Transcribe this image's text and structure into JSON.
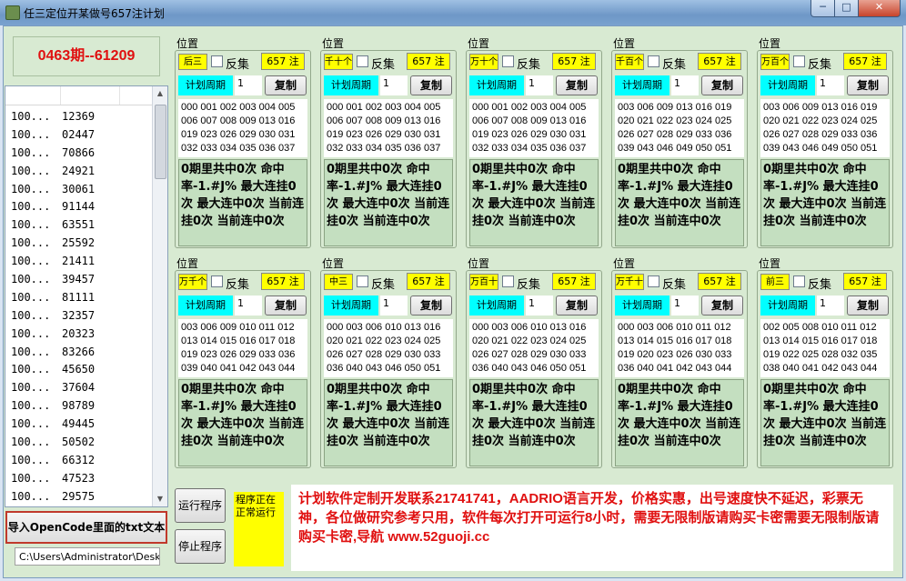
{
  "window": {
    "title": "任三定位开某做号657注计划",
    "minimize": "─",
    "maximize": "□",
    "close": "✕"
  },
  "left": {
    "issue": "0463期--61209",
    "list": [
      [
        "100...",
        "12369"
      ],
      [
        "100...",
        "02447"
      ],
      [
        "100...",
        "70866"
      ],
      [
        "100...",
        "24921"
      ],
      [
        "100...",
        "30061"
      ],
      [
        "100...",
        "91144"
      ],
      [
        "100...",
        "63551"
      ],
      [
        "100...",
        "25592"
      ],
      [
        "100...",
        "21411"
      ],
      [
        "100...",
        "39457"
      ],
      [
        "100...",
        "81111"
      ],
      [
        "100...",
        "32357"
      ],
      [
        "100...",
        "20323"
      ],
      [
        "100...",
        "83266"
      ],
      [
        "100...",
        "45650"
      ],
      [
        "100...",
        "37604"
      ],
      [
        "100...",
        "98789"
      ],
      [
        "100...",
        "49445"
      ],
      [
        "100...",
        "50502"
      ],
      [
        "100...",
        "66312"
      ],
      [
        "100...",
        "47523"
      ],
      [
        "100...",
        "29575"
      ]
    ],
    "import_button": "导入OpenCode里面的txt文本",
    "path": "C:\\Users\\Administrator\\Desk"
  },
  "panels": [
    {
      "pos": "位置",
      "sel": "后三",
      "reverse": "反集",
      "notes": "657 注",
      "period": "计划周期",
      "period_value": "1",
      "copy": "复制",
      "numbers": "000 001 002 003 004 005 006 007 008 009 013 016 019 023 026 029 030 031 032 033 034 035 036 037",
      "stats": "0期里共中0次 命中率-1.#J% 最大连挂0次 最大连中0次 当前连挂0次 当前连中0次"
    },
    {
      "pos": "位置",
      "sel": "千十个",
      "reverse": "反集",
      "notes": "657 注",
      "period": "计划周期",
      "period_value": "1",
      "copy": "复制",
      "numbers": "000 001 002 003 004 005 006 007 008 009 013 016 019 023 026 029 030 031 032 033 034 035 036 037",
      "stats": "0期里共中0次 命中率-1.#J% 最大连挂0次 最大连中0次 当前连挂0次 当前连中0次"
    },
    {
      "pos": "位置",
      "sel": "万十个",
      "reverse": "反集",
      "notes": "657 注",
      "period": "计划周期",
      "period_value": "1",
      "copy": "复制",
      "numbers": "000 001 002 003 004 005 006 007 008 009 013 016 019 023 026 029 030 031 032 033 034 035 036 037",
      "stats": "0期里共中0次 命中率-1.#J% 最大连挂0次 最大连中0次 当前连挂0次 当前连中0次"
    },
    {
      "pos": "位置",
      "sel": "千百个",
      "reverse": "反集",
      "notes": "657 注",
      "period": "计划周期",
      "period_value": "1",
      "copy": "复制",
      "numbers": "003 006 009 013 016 019 020 021 022 023 024 025 026 027 028 029 033 036 039 043 046 049 050 051",
      "stats": "0期里共中0次 命中率-1.#J% 最大连挂0次 最大连中0次 当前连挂0次 当前连中0次"
    },
    {
      "pos": "位置",
      "sel": "万百个",
      "reverse": "反集",
      "notes": "657 注",
      "period": "计划周期",
      "period_value": "1",
      "copy": "复制",
      "numbers": "003 006 009 013 016 019 020 021 022 023 024 025 026 027 028 029 033 036 039 043 046 049 050 051",
      "stats": "0期里共中0次 命中率-1.#J% 最大连挂0次 最大连中0次 当前连挂0次 当前连中0次"
    },
    {
      "pos": "位置",
      "sel": "万千个",
      "reverse": "反集",
      "notes": "657 注",
      "period": "计划周期",
      "period_value": "1",
      "copy": "复制",
      "numbers": "003 006 009 010 011 012 013 014 015 016 017 018 019 023 026 029 033 036 039 040 041 042 043 044",
      "stats": "0期里共中0次 命中率-1.#J% 最大连挂0次 最大连中0次 当前连挂0次 当前连中0次"
    },
    {
      "pos": "位置",
      "sel": "中三",
      "reverse": "反集",
      "notes": "657 注",
      "period": "计划周期",
      "period_value": "1",
      "copy": "复制",
      "numbers": "000 003 006 010 013 016 020 021 022 023 024 025 026 027 028 029 030 033 036 040 043 046 050 051",
      "stats": "0期里共中0次 命中率-1.#J% 最大连挂0次 最大连中0次 当前连挂0次 当前连中0次"
    },
    {
      "pos": "位置",
      "sel": "万百十",
      "reverse": "反集",
      "notes": "657 注",
      "period": "计划周期",
      "period_value": "1",
      "copy": "复制",
      "numbers": "000 003 006 010 013 016 020 021 022 023 024 025 026 027 028 029 030 033 036 040 043 046 050 051",
      "stats": "0期里共中0次 命中率-1.#J% 最大连挂0次 最大连中0次 当前连挂0次 当前连中0次"
    },
    {
      "pos": "位置",
      "sel": "万千十",
      "reverse": "反集",
      "notes": "657 注",
      "period": "计划周期",
      "period_value": "1",
      "copy": "复制",
      "numbers": "000 003 006 010 011 012 013 014 015 016 017 018 019 020 023 026 030 033 036 040 041 042 043 044",
      "stats": "0期里共中0次 命中率-1.#J% 最大连挂0次 最大连中0次 当前连挂0次 当前连中0次"
    },
    {
      "pos": "位置",
      "sel": "前三",
      "reverse": "反集",
      "notes": "657 注",
      "period": "计划周期",
      "period_value": "1",
      "copy": "复制",
      "numbers": "002 005 008 010 011 012 013 014 015 016 017 018 019 022 025 028 032 035 038 040 041 042 043 044",
      "stats": "0期里共中0次 命中率-1.#J% 最大连挂0次 最大连中0次 当前连挂0次 当前连中0次"
    }
  ],
  "bottom": {
    "run": "运行程序",
    "stop": "停止程序",
    "status": "程序正在正常运行",
    "info": "计划软件定制开发联系21741741，AADRIO语言开发，价格实惠，出号速度快不延迟，彩票无神，各位做研究参考只用，软件每次打开可运行8小时，需要无限制版请购买卡密需要无限制版请购买卡密,导航 www.52guoji.cc"
  },
  "colors": {
    "issue": "#e01010",
    "info": "#e01010",
    "selector": "#ffff00",
    "period": "#00ffff",
    "stats_bg": "#c4dfc0"
  }
}
